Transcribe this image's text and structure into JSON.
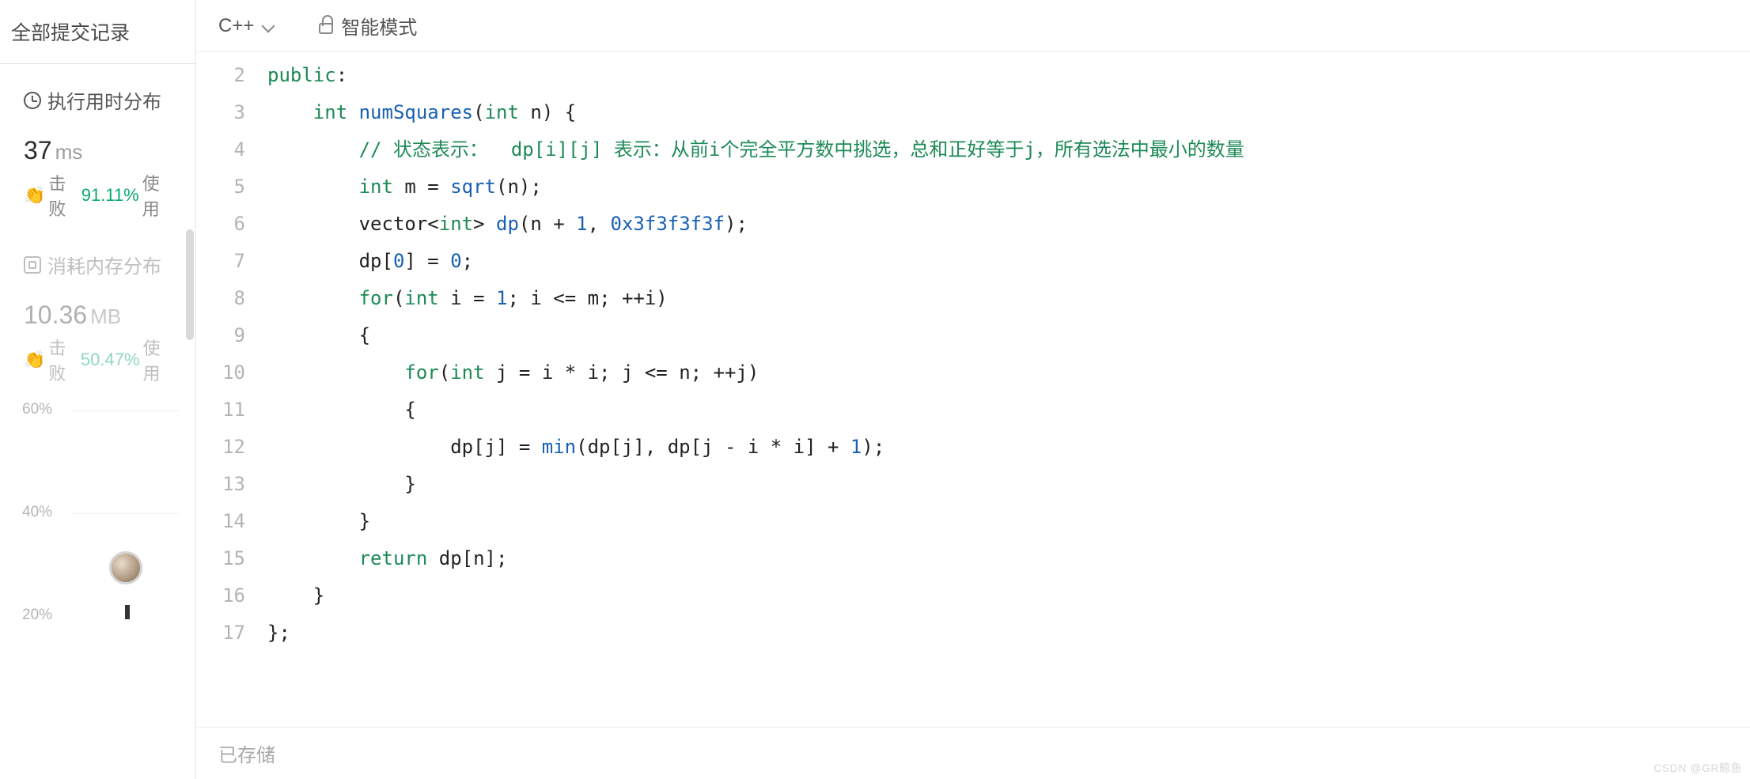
{
  "sidebar": {
    "title": "全部提交记录",
    "runtime": {
      "label": "执行用时分布",
      "value": "37",
      "unit": "ms",
      "beats_prefix": "击败",
      "beats_pct": "91.11%",
      "beats_suffix": "使用"
    },
    "memory": {
      "label": "消耗内存分布",
      "value": "10.36",
      "unit": "MB",
      "beats_prefix": "击败",
      "beats_pct": "50.47%",
      "beats_suffix": "使用"
    }
  },
  "chart_data": {
    "type": "bar",
    "ylabel": "",
    "yticks": [
      "60%",
      "40%",
      "20%"
    ],
    "categories": [],
    "values": []
  },
  "toolbar": {
    "language": "C++",
    "mode": "智能模式"
  },
  "editor": {
    "start_line": 2,
    "lines": [
      {
        "tokens": [
          [
            "kw",
            "public"
          ],
          [
            "p",
            ":"
          ]
        ]
      },
      {
        "indent": 1,
        "tokens": [
          [
            "kw",
            "int"
          ],
          [
            "sp",
            " "
          ],
          [
            "fn",
            "numSquares"
          ],
          [
            "p",
            "("
          ],
          [
            "kw",
            "int"
          ],
          [
            "sp",
            " "
          ],
          [
            "ident",
            "n"
          ],
          [
            "p",
            ") {"
          ]
        ]
      },
      {
        "indent": 2,
        "tokens": [
          [
            "cm",
            "// 状态表示：  dp[i][j] 表示：从前i个完全平方数中挑选，总和正好等于j，所有选法中最小的数量"
          ]
        ]
      },
      {
        "indent": 2,
        "tokens": [
          [
            "kw",
            "int"
          ],
          [
            "sp",
            " "
          ],
          [
            "ident",
            "m = "
          ],
          [
            "fn",
            "sqrt"
          ],
          [
            "p",
            "(n);"
          ]
        ]
      },
      {
        "indent": 2,
        "tokens": [
          [
            "ident",
            "vector<"
          ],
          [
            "kw",
            "int"
          ],
          [
            "ident",
            "> "
          ],
          [
            "fn",
            "dp"
          ],
          [
            "p",
            "(n + "
          ],
          [
            "num",
            "1"
          ],
          [
            "p",
            ", "
          ],
          [
            "num",
            "0x3f3f3f3f"
          ],
          [
            "p",
            ");"
          ]
        ]
      },
      {
        "indent": 2,
        "tokens": [
          [
            "ident",
            "dp["
          ],
          [
            "num",
            "0"
          ],
          [
            "ident",
            "] = "
          ],
          [
            "num",
            "0"
          ],
          [
            "p",
            ";"
          ]
        ]
      },
      {
        "indent": 2,
        "tokens": [
          [
            "kw",
            "for"
          ],
          [
            "p",
            "("
          ],
          [
            "kw",
            "int"
          ],
          [
            "sp",
            " "
          ],
          [
            "ident",
            "i = "
          ],
          [
            "num",
            "1"
          ],
          [
            "ident",
            "; i <= m; ++i)"
          ]
        ]
      },
      {
        "indent": 2,
        "tokens": [
          [
            "p",
            "{"
          ]
        ]
      },
      {
        "indent": 3,
        "tokens": [
          [
            "kw",
            "for"
          ],
          [
            "p",
            "("
          ],
          [
            "kw",
            "int"
          ],
          [
            "sp",
            " "
          ],
          [
            "ident",
            "j = i * i; j <= n; ++j)"
          ]
        ]
      },
      {
        "indent": 3,
        "tokens": [
          [
            "p",
            "{"
          ]
        ]
      },
      {
        "indent": 4,
        "tokens": [
          [
            "ident",
            "dp[j] = "
          ],
          [
            "fn",
            "min"
          ],
          [
            "p",
            "(dp[j], dp[j - i * i] + "
          ],
          [
            "num",
            "1"
          ],
          [
            "p",
            ");"
          ]
        ]
      },
      {
        "indent": 3,
        "tokens": [
          [
            "p",
            "}"
          ]
        ]
      },
      {
        "indent": 2,
        "tokens": [
          [
            "p",
            "}"
          ]
        ]
      },
      {
        "indent": 2,
        "tokens": [
          [
            "kw",
            "return"
          ],
          [
            "sp",
            " "
          ],
          [
            "ident",
            "dp[n];"
          ]
        ]
      },
      {
        "indent": 1,
        "tokens": [
          [
            "p",
            "}"
          ]
        ]
      },
      {
        "indent": 0,
        "tokens": [
          [
            "p",
            "};"
          ]
        ]
      }
    ]
  },
  "status": "已存储",
  "watermark": "CSDN @GR鲸鱼"
}
